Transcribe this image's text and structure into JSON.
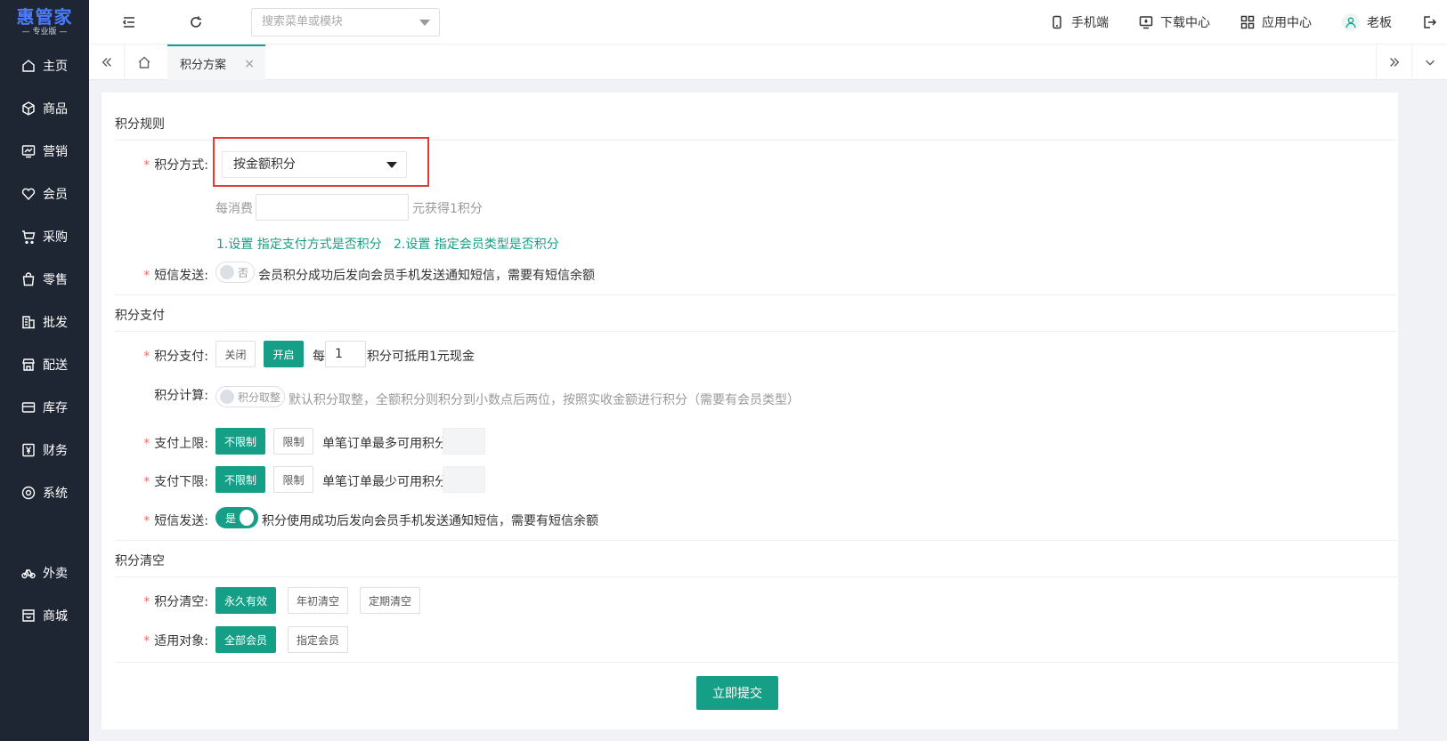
{
  "app": {
    "logo_name": "惠管家",
    "logo_version": "— 专业版 —"
  },
  "sidebar": {
    "items": [
      {
        "label": "主页",
        "icon": "home-icon"
      },
      {
        "label": "商品",
        "icon": "box-icon"
      },
      {
        "label": "营销",
        "icon": "chart-icon"
      },
      {
        "label": "会员",
        "icon": "heart-icon"
      },
      {
        "label": "采购",
        "icon": "cart-icon"
      },
      {
        "label": "零售",
        "icon": "bag-icon"
      },
      {
        "label": "批发",
        "icon": "building-icon"
      },
      {
        "label": "配送",
        "icon": "store-icon"
      },
      {
        "label": "库存",
        "icon": "inventory-icon"
      },
      {
        "label": "财务",
        "icon": "yen-icon"
      },
      {
        "label": "系统",
        "icon": "settings-icon"
      },
      {
        "label": "外卖",
        "icon": "bike-icon"
      },
      {
        "label": "商城",
        "icon": "shop-icon"
      }
    ]
  },
  "header": {
    "search_placeholder": "搜索菜单或模块",
    "menu": {
      "mobile": "手机端",
      "download": "下载中心",
      "apps": "应用中心",
      "user": "老板"
    }
  },
  "tabs": {
    "active": "积分方案",
    "close": "×"
  },
  "form": {
    "section_rules": "积分规则",
    "method_label": "积分方式:",
    "method_value": "按金额积分",
    "spend_prefix": "每消费",
    "spend_value": "",
    "spend_suffix": "元获得1积分",
    "link1": "1.设置 指定支付方式是否积分",
    "link2": "2.设置 指定会员类型是否积分",
    "sms1_label": "短信发送:",
    "sms1_switch": "否",
    "sms1_desc": "会员积分成功后发向会员手机发送通知短信，需要有短信余额",
    "section_pay": "积分支付",
    "pay_label": "积分支付:",
    "pay_off": "关闭",
    "pay_on": "开启",
    "pay_each": "每",
    "pay_value": "1",
    "pay_suffix": "积分可抵用1元现金",
    "calc_label": "积分计算:",
    "calc_switch": "积分取整",
    "calc_desc": "默认积分取整，全额积分则积分到小数点后两位，按照实收金额进行积分（需要有会员类型）",
    "upper_label": "支付上限:",
    "upper_unlimited": "不限制",
    "upper_limit": "限制",
    "upper_desc": "单笔订单最多可用积分",
    "lower_label": "支付下限:",
    "lower_unlimited": "不限制",
    "lower_limit": "限制",
    "lower_desc": "单笔订单最少可用积分",
    "sms2_label": "短信发送:",
    "sms2_switch": "是",
    "sms2_desc": "积分使用成功后发向会员手机发送通知短信，需要有短信余额",
    "section_clear": "积分清空",
    "clear_label": "积分清空:",
    "clear_forever": "永久有效",
    "clear_year": "年初清空",
    "clear_period": "定期清空",
    "target_label": "适用对象:",
    "target_all": "全部会员",
    "target_some": "指定会员",
    "submit": "立即提交"
  },
  "colors": {
    "accent": "#159f86",
    "sidebar": "#1f2633",
    "required": "#f56c6c",
    "highlight": "#e53935"
  }
}
